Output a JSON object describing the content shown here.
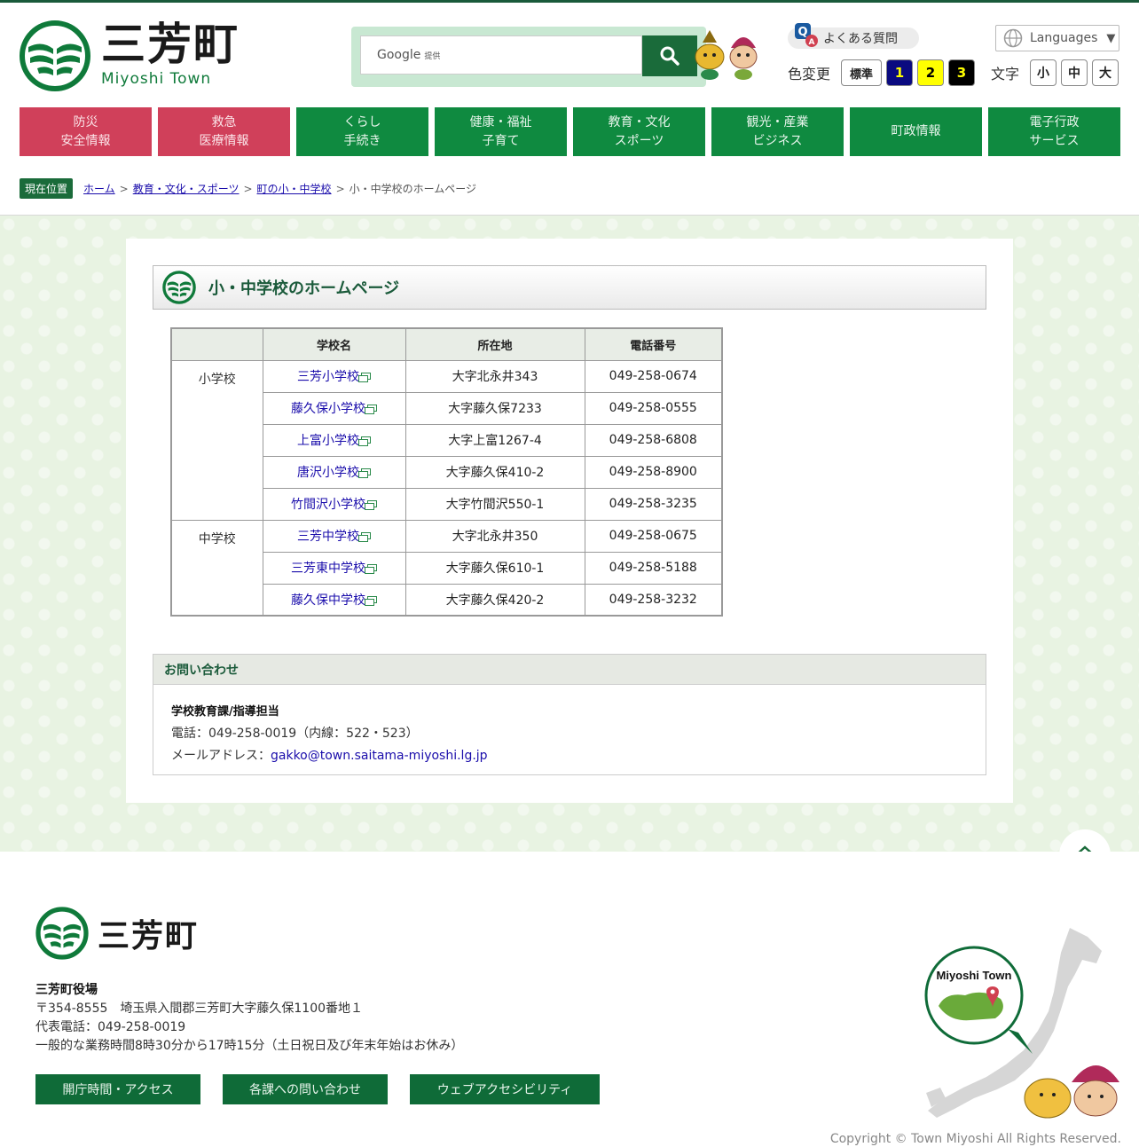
{
  "header": {
    "logo_jp": "三芳町",
    "logo_en": "Miyoshi Town",
    "search": {
      "google_label": "Google",
      "provided": "提供"
    },
    "faq_label": "よくある質問",
    "languages_label": "Languages",
    "color_label": "色変更",
    "color_buttons": [
      "標準",
      "1",
      "2",
      "3"
    ],
    "text_label": "文字",
    "text_buttons": [
      "小",
      "中",
      "大"
    ]
  },
  "gnav": [
    "防災\n安全情報",
    "救急\n医療情報",
    "くらし\n手続き",
    "健康・福祉\n子育て",
    "教育・文化\nスポーツ",
    "観光・産業\nビジネス",
    "町政情報",
    "電子行政\nサービス"
  ],
  "breadcrumb": {
    "tag": "現在位置",
    "links": [
      "ホーム",
      "教育・文化・スポーツ",
      "町の小・中学校"
    ],
    "sep": ">",
    "current": "小・中学校のホームページ"
  },
  "page_title": "小・中学校のホームページ",
  "table": {
    "headers": [
      "",
      "学校名",
      "所在地",
      "電話番号"
    ],
    "categories": [
      "小学校",
      "中学校"
    ],
    "rows": [
      {
        "name": "三芳小学校",
        "address": "大字北永井343",
        "phone": "049-258-0674"
      },
      {
        "name": "藤久保小学校",
        "address": "大字藤久保7233",
        "phone": "049-258-0555"
      },
      {
        "name": "上富小学校",
        "address": "大字上富1267-4",
        "phone": "049-258-6808"
      },
      {
        "name": "唐沢小学校",
        "address": "大字藤久保410-2",
        "phone": "049-258-8900"
      },
      {
        "name": "竹間沢小学校",
        "address": "大字竹間沢550-1",
        "phone": "049-258-3235"
      },
      {
        "name": "三芳中学校",
        "address": "大字北永井350",
        "phone": "049-258-0675"
      },
      {
        "name": "三芳東中学校",
        "address": "大字藤久保610-1",
        "phone": "049-258-5188"
      },
      {
        "name": "藤久保中学校",
        "address": "大字藤久保420-2",
        "phone": "049-258-3232"
      }
    ]
  },
  "contact": {
    "heading": "お問い合わせ",
    "dept": "学校教育課/指導担当",
    "phone": "電話：049-258-0019（内線：522・523）",
    "email_label": "メールアドレス：",
    "email": "gakko@town.saitama-miyoshi.lg.jp"
  },
  "footer": {
    "logo": "三芳町",
    "office": "三芳町役場",
    "address": "〒354-8555　埼玉県入間郡三芳町大字藤久保1100番地１",
    "phone": "代表電話：049-258-0019",
    "hours": "一般的な業務時間8時30分から17時15分（土日祝日及び年末年始はお休み）",
    "buttons": [
      "開庁時間・アクセス",
      "各課への問い合わせ",
      "ウェブアクセシビリティ"
    ],
    "map_label": "Miyoshi Town",
    "copyright": "Copyright © Town Miyoshi All Rights Reserved."
  },
  "colors": {
    "brand_green": "#0f8a40",
    "alert_red": "#d0405a",
    "dark_green": "#1a6b3a"
  }
}
